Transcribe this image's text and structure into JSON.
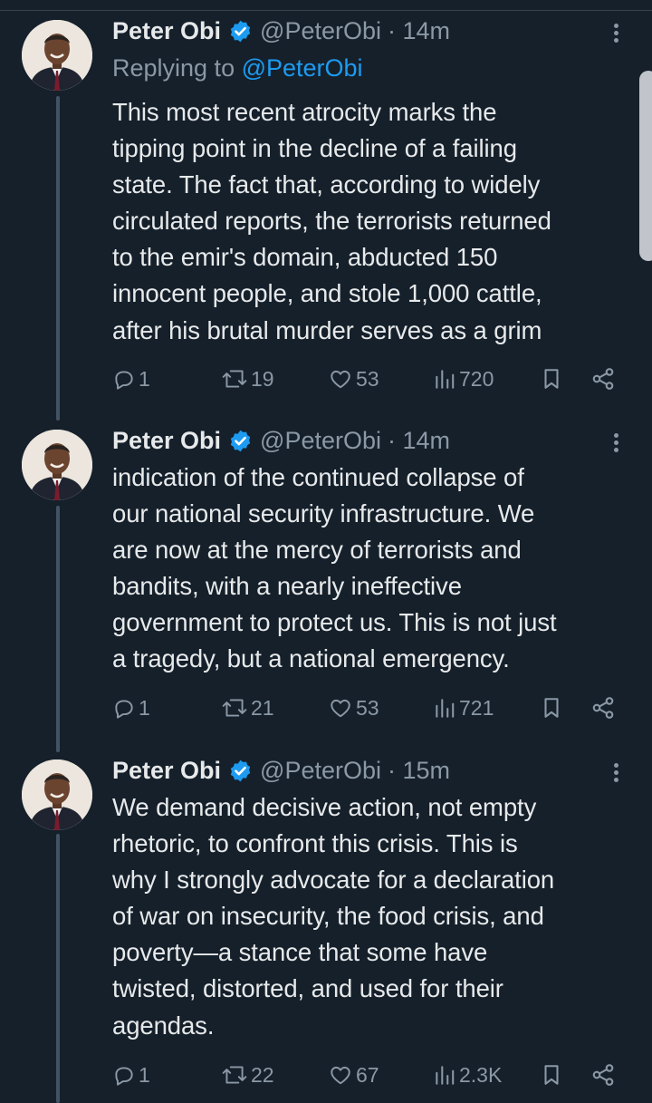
{
  "colors": {
    "background": "#15202b",
    "text": "#e7e9ea",
    "muted": "#8b98a5",
    "accent": "#1d9bf0"
  },
  "tweets": [
    {
      "author": "Peter Obi",
      "handle": "@PeterObi",
      "time": "· 14m",
      "reply_prefix": "Replying to ",
      "reply_handle": "@PeterObi",
      "text": "This most recent atrocity marks the\ntipping point in the decline of a failing\nstate. The fact that, according to widely\ncirculated reports, the terrorists returned\nto the emir's domain, abducted 150\ninnocent people, and stole 1,000 cattle,\nafter his brutal murder serves as a grim",
      "replies": "1",
      "reposts": "19",
      "likes": "53",
      "views": "720"
    },
    {
      "author": "Peter Obi",
      "handle": "@PeterObi",
      "time": "· 14m",
      "text": "indication of the continued collapse of\nour national security infrastructure. We\nare now at the mercy of terrorists and\nbandits, with a nearly ineffective\ngovernment to protect us. This is not just\na tragedy, but a national emergency.",
      "replies": "1",
      "reposts": "21",
      "likes": "53",
      "views": "721"
    },
    {
      "author": "Peter Obi",
      "handle": "@PeterObi",
      "time": "· 15m",
      "text": "We demand decisive action, not empty\nrhetoric, to confront this crisis. This is\nwhy I strongly advocate for a declaration\nof war on insecurity, the food crisis, and\npoverty—a stance that some have\ntwisted, distorted, and used for their\nagendas.",
      "replies": "1",
      "reposts": "22",
      "likes": "67",
      "views": "2.3K"
    }
  ],
  "icons": [
    "verified-badge-icon",
    "more-options-icon",
    "reply-icon",
    "repost-icon",
    "like-icon",
    "views-icon",
    "bookmark-icon",
    "share-icon"
  ]
}
